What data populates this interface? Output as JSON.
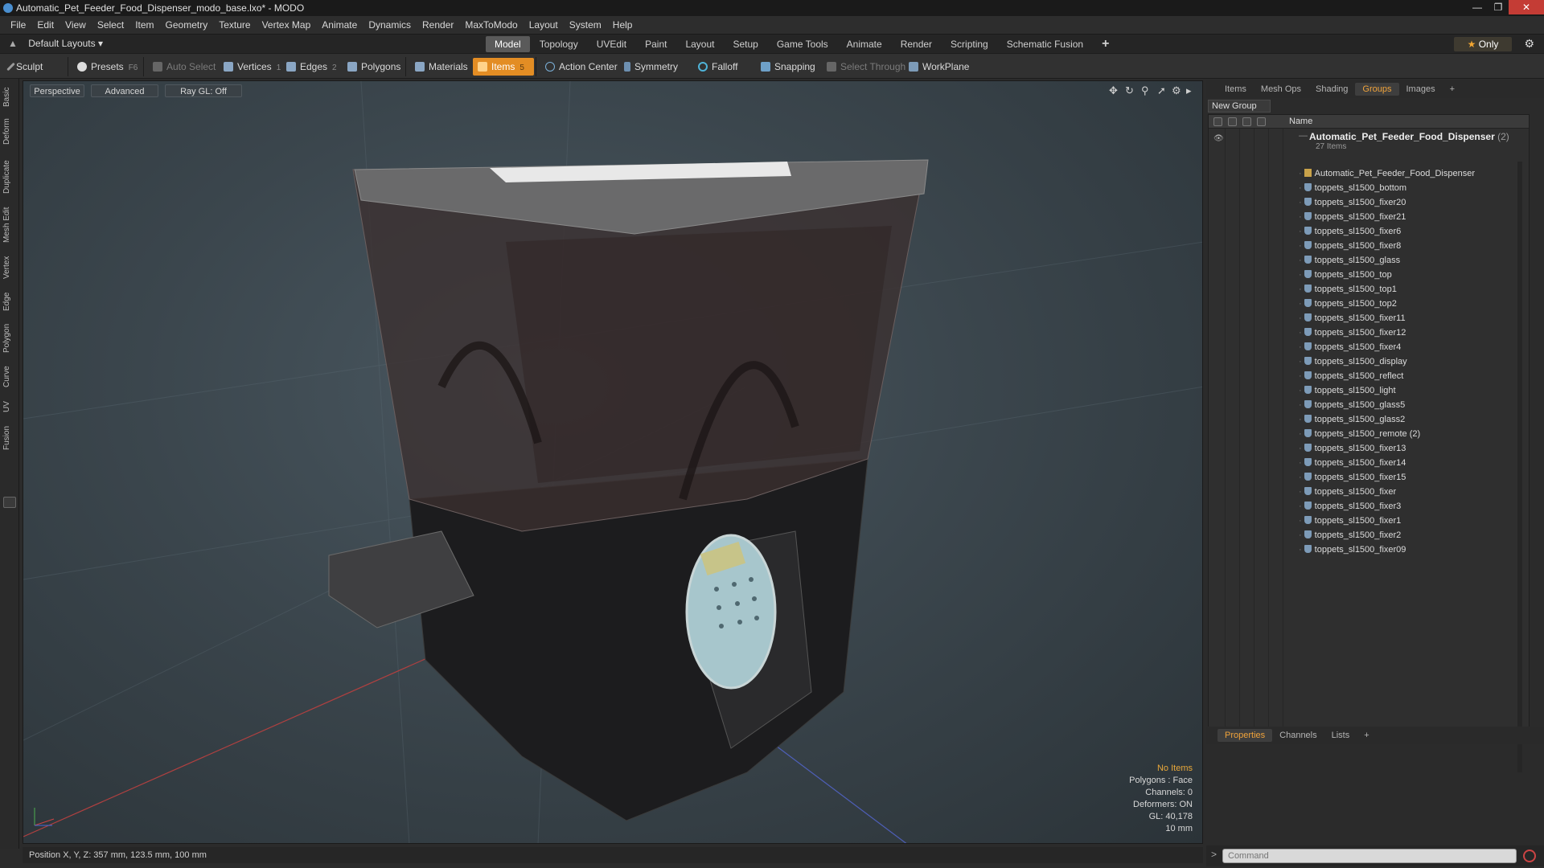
{
  "window": {
    "title": "Automatic_Pet_Feeder_Food_Dispenser_modo_base.lxo* - MODO",
    "buttons": [
      "minimize",
      "maximize",
      "close"
    ]
  },
  "menu": [
    "File",
    "Edit",
    "View",
    "Select",
    "Item",
    "Geometry",
    "Texture",
    "Vertex Map",
    "Animate",
    "Dynamics",
    "Render",
    "MaxToModo",
    "Layout",
    "System",
    "Help"
  ],
  "layout_bar": {
    "layouts_label": "Default Layouts",
    "tabs": [
      "Model",
      "Topology",
      "UVEdit",
      "Paint",
      "Layout",
      "Setup",
      "Game Tools",
      "Animate",
      "Render",
      "Scripting",
      "Schematic Fusion"
    ],
    "active_tab": "Model",
    "plus": "+",
    "only_label": "Only"
  },
  "toolbar": {
    "sculpt": "Sculpt",
    "presets": "Presets",
    "presets_key": "F6",
    "auto_select": "Auto Select",
    "vertices": "Vertices",
    "vertices_count": "1",
    "edges": "Edges",
    "edges_count": "2",
    "polygons": "Polygons",
    "materials": "Materials",
    "items": "Items",
    "items_count": "5",
    "action_center": "Action Center",
    "symmetry": "Symmetry",
    "falloff": "Falloff",
    "snapping": "Snapping",
    "select_through": "Select Through",
    "workplane": "WorkPlane"
  },
  "left_tabs": [
    "Basic",
    "Deform",
    "Duplicate",
    "Mesh Edit",
    "Vertex",
    "Edge",
    "Polygon",
    "Curve",
    "UV",
    "Fusion"
  ],
  "viewport": {
    "view_mode": "Perspective",
    "shading": "Advanced",
    "ray_gl": "Ray GL: Off",
    "stats": {
      "selection": "No Items",
      "polygons": "Polygons : Face",
      "channels": "Channels: 0",
      "deformers": "Deformers: ON",
      "gl": "GL: 40,178",
      "unit": "10 mm"
    }
  },
  "status_bar": {
    "position": "Position X, Y, Z:  357 mm, 123.5 mm, 100 mm"
  },
  "right_panel": {
    "top_tabs": [
      "Items",
      "Mesh Ops",
      "Shading",
      "Groups",
      "Images"
    ],
    "active_top_tab": "Groups",
    "new_group": "New Group",
    "column_name": "Name",
    "group": {
      "name": "Automatic_Pet_Feeder_Food_Dispenser",
      "suffix": "(2)",
      "count": "27 Items"
    },
    "items": [
      "Automatic_Pet_Feeder_Food_Dispenser",
      "toppets_sl1500_bottom",
      "toppets_sl1500_fixer20",
      "toppets_sl1500_fixer21",
      "toppets_sl1500_fixer6",
      "toppets_sl1500_fixer8",
      "toppets_sl1500_glass",
      "toppets_sl1500_top",
      "toppets_sl1500_top1",
      "toppets_sl1500_top2",
      "toppets_sl1500_fixer11",
      "toppets_sl1500_fixer12",
      "toppets_sl1500_fixer4",
      "toppets_sl1500_display",
      "toppets_sl1500_reflect",
      "toppets_sl1500_light",
      "toppets_sl1500_glass5",
      "toppets_sl1500_glass2",
      "toppets_sl1500_remote (2)",
      "toppets_sl1500_fixer13",
      "toppets_sl1500_fixer14",
      "toppets_sl1500_fixer15",
      "toppets_sl1500_fixer",
      "toppets_sl1500_fixer3",
      "toppets_sl1500_fixer1",
      "toppets_sl1500_fixer2",
      "toppets_sl1500_fixer09"
    ],
    "bottom_tabs": [
      "Properties",
      "Channels",
      "Lists"
    ],
    "active_bottom_tab": "Properties",
    "command_placeholder": "Command"
  },
  "colors": {
    "accent": "#e38d24",
    "active_tab_text": "#f0a33b",
    "viewport_bg": "#3b464d"
  }
}
